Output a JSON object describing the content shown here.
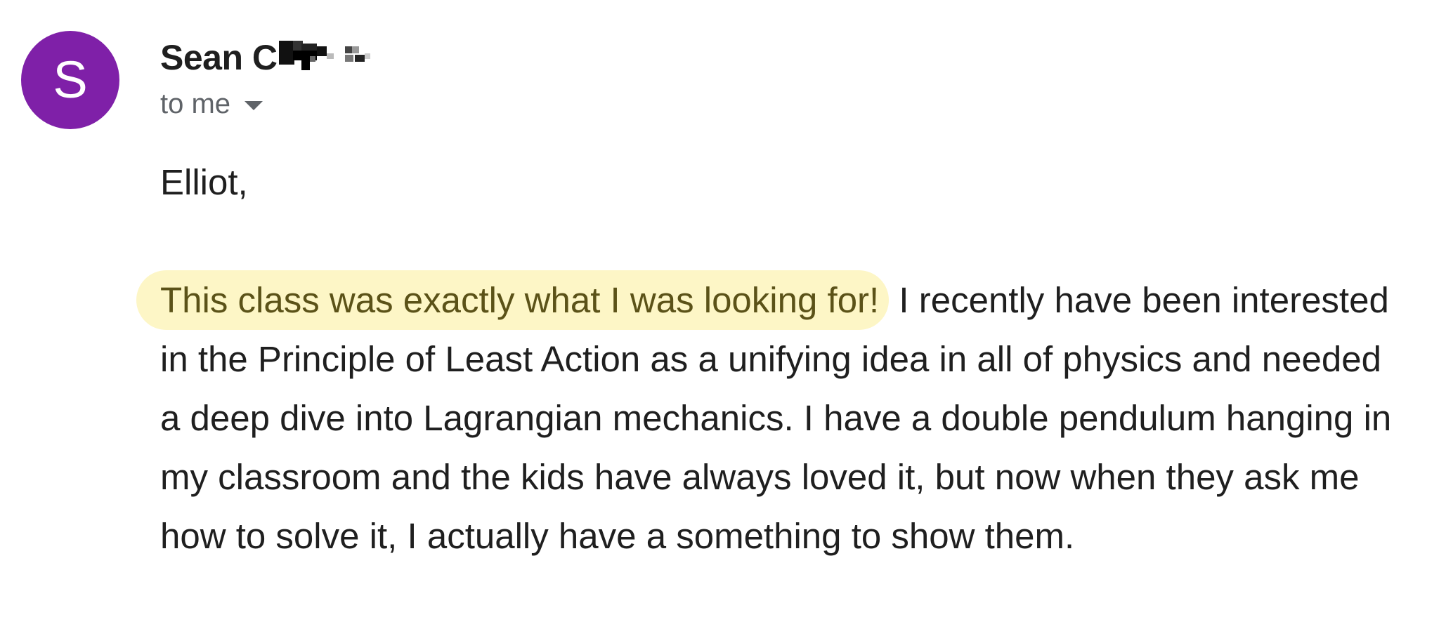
{
  "email": {
    "avatar_letter": "S",
    "avatar_color": "#7f20a8",
    "sender_name": "Sean C",
    "recipient_label": "to me",
    "greeting": "Elliot,",
    "highlight_text": "This class was exactly what I was looking for!",
    "highlight_color": "#fdf6c6",
    "body_rest": " I recently have been interested in the Principle of Least Action as a unifying idea in all of physics and needed a deep dive into Lagrangian mechanics. I have a double pendulum hanging in my classroom and the kids have always loved it, but now when they ask me how to solve it, I actually have a something to show them."
  }
}
